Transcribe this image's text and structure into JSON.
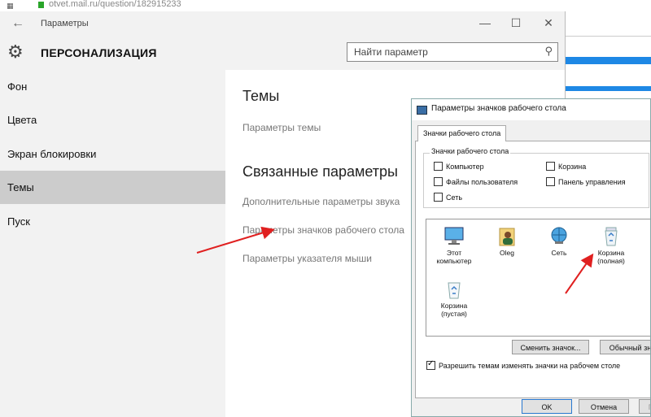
{
  "browser": {
    "url": "otvet.mail.ru/question/182915233"
  },
  "settings_window": {
    "title": "Параметры",
    "controls": {
      "minimize": "—",
      "maximize": "☐",
      "close": "✕"
    },
    "back_icon": "←",
    "header_title": "ПЕРСОНАЛИЗАЦИЯ",
    "search_placeholder": "Найти параметр",
    "sidebar": [
      {
        "label": "Фон"
      },
      {
        "label": "Цвета"
      },
      {
        "label": "Экран блокировки"
      },
      {
        "label": "Темы",
        "active": true
      },
      {
        "label": "Пуск"
      }
    ],
    "content": {
      "heading": "Темы",
      "theme_settings_link": "Параметры темы",
      "related_heading": "Связанные параметры",
      "links": [
        "Дополнительные параметры звука",
        "Параметры значков рабочего стола",
        "Параметры указателя мыши"
      ]
    }
  },
  "dialog": {
    "title": "Параметры значков рабочего стола",
    "tab": "Значки рабочего стола",
    "group_label": "Значки рабочего стола",
    "checkboxes": [
      {
        "label": "Компьютер",
        "checked": false
      },
      {
        "label": "Корзина",
        "checked": false
      },
      {
        "label": "Файлы пользователя",
        "checked": false
      },
      {
        "label": "Панель управления",
        "checked": false
      },
      {
        "label": "Сеть",
        "checked": false
      }
    ],
    "icons": [
      {
        "label": "Этот компьютер",
        "icon": "computer-icon"
      },
      {
        "label": "Oleg",
        "icon": "user-folder-icon"
      },
      {
        "label": "Сеть",
        "icon": "network-icon"
      },
      {
        "label": "Корзина (полная)",
        "icon": "recycle-bin-full-icon"
      },
      {
        "label": "Корзина (пустая)",
        "icon": "recycle-bin-empty-icon"
      }
    ],
    "change_icon_button": "Сменить значок...",
    "default_button": "Обычный зна",
    "allow_themes_label": "Разрешить темам изменять значки на рабочем столе",
    "allow_themes_checked": true,
    "ok_button": "OK",
    "cancel_button": "Отмена",
    "apply_button": "При"
  },
  "colors": {
    "accent": "#1e88e5",
    "annotation": "#e02020",
    "selected_nav": "#cccccc"
  }
}
